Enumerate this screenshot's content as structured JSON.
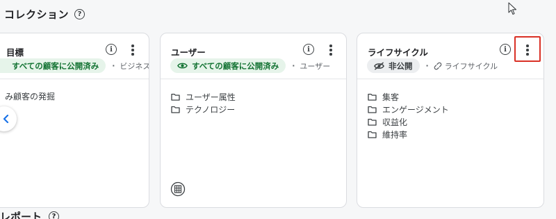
{
  "section": {
    "title": "コレクション",
    "help_icon": "question-circle-icon"
  },
  "cards": [
    {
      "title": "目標",
      "chip": "すべての顧客に公開済み",
      "meta": "ビジネス...",
      "items": [
        "み顧客の発掘"
      ]
    },
    {
      "title": "ユーザー",
      "chip": "すべての顧客に公開済み",
      "meta": "ユーザー",
      "items": [
        "ユーザー属性",
        "テクノロジー"
      ]
    },
    {
      "title": "ライフサイクル",
      "chip": "非公開",
      "meta": "ライフサイクル",
      "items": [
        "集客",
        "エンゲージメント",
        "収益化",
        "維持率"
      ]
    }
  ],
  "next_section": {
    "title": "レポート"
  },
  "colors": {
    "published_bg": "#e6f4ea",
    "published_text": "#137333",
    "highlight": "#d93025",
    "accent": "#1a73e8"
  }
}
